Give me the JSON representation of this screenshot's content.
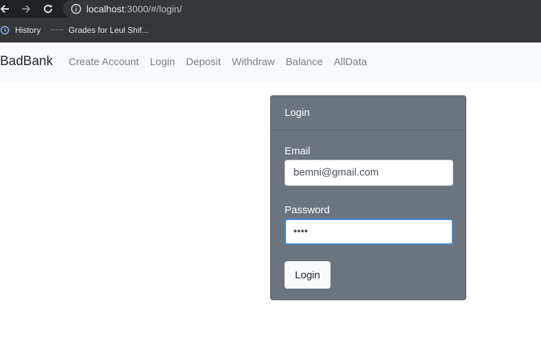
{
  "browser": {
    "url_host": "localhost",
    "url_path": ":3000/#/login/",
    "bookmarks": [
      {
        "label": "History"
      },
      {
        "label": "Grades for Leul Shif..."
      }
    ]
  },
  "navbar": {
    "brand": "BadBank",
    "links": [
      "Create Account",
      "Login",
      "Deposit",
      "Withdraw",
      "Balance",
      "AllData"
    ]
  },
  "card": {
    "header": "Login",
    "email_label": "Email",
    "email_value": "bemni@gmail.com",
    "password_label": "Password",
    "password_value": "••••",
    "submit_label": "Login"
  },
  "colors": {
    "card_bg": "#6c757d",
    "navbar_bg": "#f8f9fa",
    "focus": "#3d8bd4"
  }
}
